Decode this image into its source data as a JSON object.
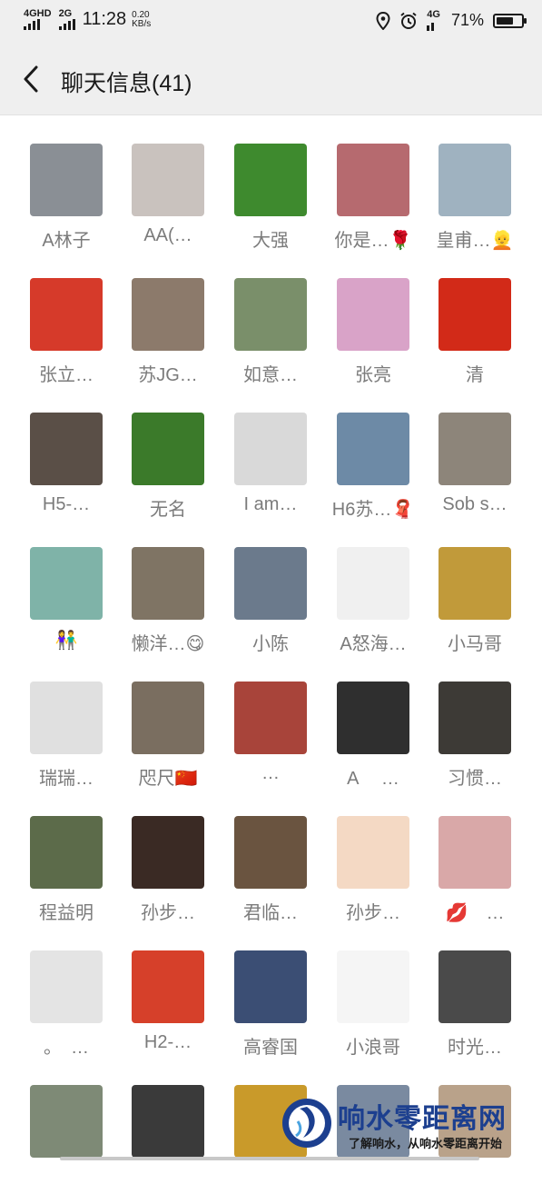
{
  "status_bar": {
    "network1": "4GHD",
    "network2": "2G",
    "time": "11:28",
    "speed_value": "0.20",
    "speed_unit": "KB/s",
    "network3": "4G",
    "battery": "71%",
    "battery_level": 0.71
  },
  "header": {
    "title": "聊天信息(41)"
  },
  "members": [
    {
      "name": "A林子",
      "color": "#8a8f95"
    },
    {
      "name": "AA(…",
      "color": "#c9c2be"
    },
    {
      "name": "大强",
      "color": "#3e8a2e"
    },
    {
      "name": "你是…🌹",
      "color": "#b66a6f"
    },
    {
      "name": "皇甫…👱",
      "color": "#9fb2c0"
    },
    {
      "name": "张立…",
      "color": "#d63a2a"
    },
    {
      "name": "苏JG…",
      "color": "#8c7a6b"
    },
    {
      "name": "如意…",
      "color": "#7a8f6a"
    },
    {
      "name": "张亮",
      "color": "#d9a3c8"
    },
    {
      "name": "清",
      "color": "#d22a18"
    },
    {
      "name": "H5-…",
      "color": "#5a4f47"
    },
    {
      "name": "无名",
      "color": "#3b7a2a"
    },
    {
      "name": "I am…",
      "color": "#d9d9d9"
    },
    {
      "name": "H6苏…🧣",
      "color": "#6d8aa6"
    },
    {
      "name": "Sob s…",
      "color": "#8d857a"
    },
    {
      "name": "👫",
      "color": "#7fb3a8"
    },
    {
      "name": "懒洋…😋",
      "color": "#7f7464"
    },
    {
      "name": "小陈",
      "color": "#6b7a8c"
    },
    {
      "name": "A怒海…",
      "color": "#f0f0f0"
    },
    {
      "name": "小马哥",
      "color": "#c19a3a"
    },
    {
      "name": "瑞瑞…",
      "color": "#e0e0e0"
    },
    {
      "name": "咫尺🇨🇳",
      "color": "#7a6e60"
    },
    {
      "name": "…",
      "color": "#a8443a"
    },
    {
      "name": "A　 …",
      "color": "#2f2f2f"
    },
    {
      "name": "习惯…",
      "color": "#3d3a36"
    },
    {
      "name": "程益明",
      "color": "#5c6b4a"
    },
    {
      "name": "孙步…",
      "color": "#3a2a24"
    },
    {
      "name": "君临…",
      "color": "#6a5440"
    },
    {
      "name": "孙步…",
      "color": "#f4d9c4"
    },
    {
      "name": "💋　…",
      "color": "#d9a8a8"
    },
    {
      "name": "。　…",
      "color": "#e4e4e4"
    },
    {
      "name": "H2-…",
      "color": "#d6402a"
    },
    {
      "name": "高睿国",
      "color": "#3b4e74"
    },
    {
      "name": "小浪哥",
      "color": "#f5f5f5"
    },
    {
      "name": "时光…",
      "color": "#4a4a4a"
    },
    {
      "name": "",
      "color": "#7e8a76"
    },
    {
      "name": "",
      "color": "#3a3a3a"
    },
    {
      "name": "",
      "color": "#c99a2a"
    },
    {
      "name": "",
      "color": "#7a8aa0"
    },
    {
      "name": "",
      "color": "#b9a28a"
    }
  ],
  "watermark": {
    "title": "响水零距离网",
    "subtitle": "了解响水，从响水零距离开始"
  }
}
